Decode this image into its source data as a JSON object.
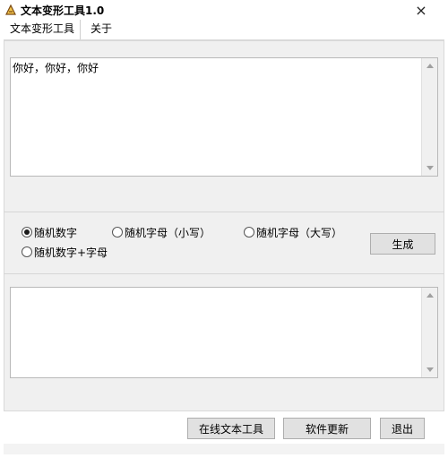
{
  "window": {
    "title": "文本变形工具1.0",
    "close_symbol": "×"
  },
  "tabs": [
    {
      "label": "文本变形工具"
    },
    {
      "label": "关于"
    }
  ],
  "input_text": "你好，你好，你好",
  "output_text": "",
  "options": [
    {
      "label": "随机数字",
      "checked": true
    },
    {
      "label": "随机字母（小写）",
      "checked": false
    },
    {
      "label": "随机字母（大写）",
      "checked": false
    },
    {
      "label": "随机数字+字母",
      "checked": false
    }
  ],
  "buttons": {
    "generate": "生成",
    "online_tools": "在线文本工具",
    "update": "软件更新",
    "exit": "退出"
  },
  "colors": {
    "panel_bg": "#f0f0f0",
    "button_bg": "#e1e1e1"
  }
}
